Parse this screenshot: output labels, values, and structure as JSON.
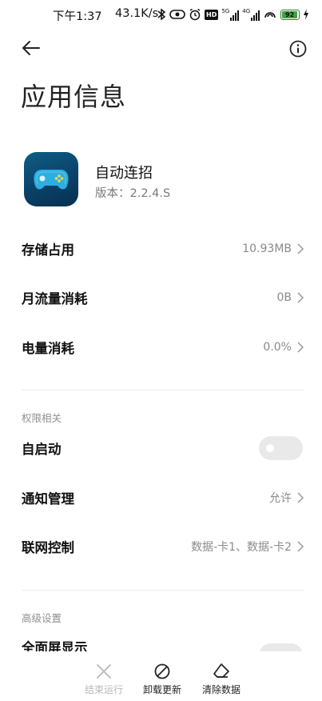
{
  "status_bar": {
    "time": "下午1:37",
    "net_speed": "43.1K/s",
    "icons": [
      "bluetooth-icon",
      "nfc-icon",
      "alarm-icon",
      "hd-icon",
      "signal-5g-icon",
      "signal-4g-icon",
      "hotspot-icon",
      "battery-icon",
      "charging-icon"
    ],
    "signal_5g": "5G",
    "signal_4g": "4G",
    "hd": "HD",
    "battery_level": "92"
  },
  "page": {
    "title": "应用信息"
  },
  "app": {
    "name": "自动连招",
    "version": "版本：2.2.4.S"
  },
  "usage_rows": [
    {
      "label": "存储占用",
      "value": "10.93MB"
    },
    {
      "label": "月流量消耗",
      "value": "0B"
    },
    {
      "label": "电量消耗",
      "value": "0.0%"
    }
  ],
  "permissions": {
    "section_title": "权限相关",
    "autostart": {
      "label": "自启动",
      "enabled": false
    },
    "notifications": {
      "label": "通知管理",
      "value": "允许"
    },
    "network": {
      "label": "联网控制",
      "value": "数据-卡1、数据-卡2"
    }
  },
  "advanced": {
    "section_title": "高级设置",
    "fullscreen_label": "全面屏显示"
  },
  "bottom_actions": [
    {
      "label": "结束运行",
      "icon": "close-icon",
      "enabled": false
    },
    {
      "label": "卸载更新",
      "icon": "prohibit-icon",
      "enabled": true
    },
    {
      "label": "清除数据",
      "icon": "eraser-icon",
      "enabled": true
    }
  ],
  "colors": {
    "accent_battery": "#43a047",
    "toggle_off": "#e9e9e9",
    "secondary_text": "#8a8a8a",
    "app_icon_bg": "#0f5d83"
  }
}
